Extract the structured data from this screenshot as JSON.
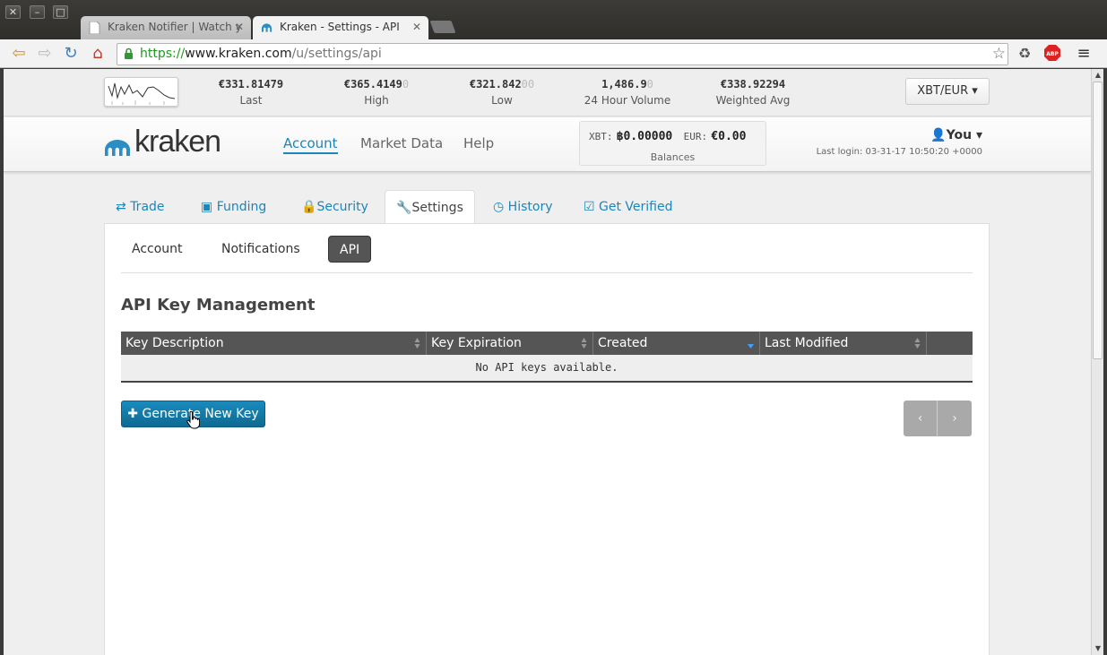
{
  "browser": {
    "tabs": [
      {
        "title": "Kraken Notifier | Watch y"
      },
      {
        "title": "Kraken - Settings - API"
      }
    ],
    "url": {
      "scheme": "https://",
      "host": "www.kraken.com",
      "path": "/u/settings/api"
    }
  },
  "ticker": {
    "last": {
      "value": "€331.81479",
      "dim": "",
      "label": "Last"
    },
    "high": {
      "value": "€365.4149",
      "dim": "0",
      "label": "High"
    },
    "low": {
      "value": "€321.842",
      "dim": "00",
      "label": "Low"
    },
    "volume": {
      "value": "1,486.9",
      "dim": "0",
      "label": "24 Hour Volume"
    },
    "wavg": {
      "value": "€338.92294",
      "dim": "",
      "label": "Weighted Avg"
    },
    "pair": "XBT/EUR ▾"
  },
  "header": {
    "logo": "kraken",
    "nav": [
      "Account",
      "Market Data",
      "Help"
    ],
    "balances": {
      "xbt_key": "XBT:",
      "xbt_value": "฿0.00000",
      "eur_key": "EUR:",
      "eur_value": "€0.00",
      "caption": "Balances"
    },
    "user": "You ▾",
    "last_login": "Last login: 03-31-17 10:50:20 +0000"
  },
  "main_tabs": [
    "Trade",
    "Funding",
    "Security",
    "Settings",
    "History",
    "Get Verified"
  ],
  "sub_tabs": [
    "Account",
    "Notifications",
    "API"
  ],
  "section_title": "API Key Management",
  "table": {
    "columns": [
      "Key Description",
      "Key Expiration",
      "Created",
      "Last Modified",
      ""
    ],
    "empty_message": "No API keys available."
  },
  "buttons": {
    "generate": "Generate New Key",
    "prev": "‹",
    "next": "›"
  },
  "colors": {
    "accent": "#1b86b9",
    "button": "#0e7aa8"
  }
}
